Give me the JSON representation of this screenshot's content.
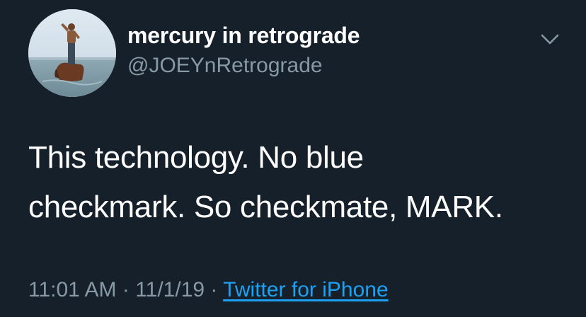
{
  "user": {
    "display_name": "mercury in retrograde",
    "handle": "@JOEYnRetrograde",
    "avatar_icon": "avatar-photo-man-standing-on-horse-in-water"
  },
  "tweet": {
    "lines": [
      "This technology. No blue",
      "checkmark. So checkmate, MARK."
    ]
  },
  "meta": {
    "time": "11:01 AM",
    "separator": " · ",
    "date": "11/1/19",
    "source": "Twitter for iPhone"
  },
  "menu": {
    "icon": "chevron-down-icon"
  },
  "colors": {
    "background": "#15202b",
    "text_primary": "#ffffff",
    "text_secondary": "#8899a6",
    "link": "#1da1f2"
  }
}
